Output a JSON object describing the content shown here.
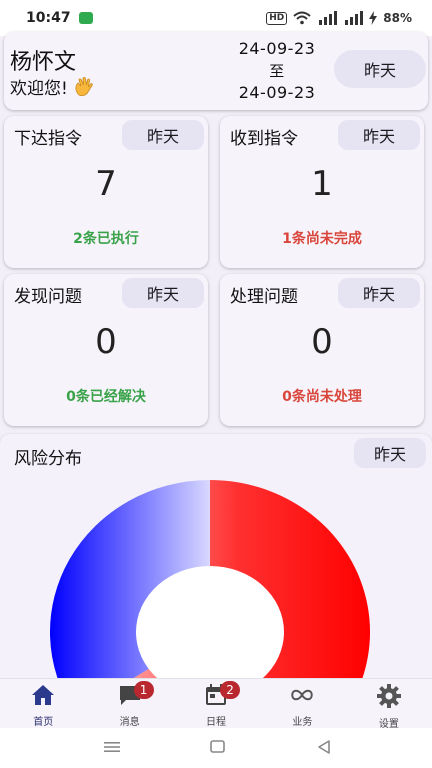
{
  "status_bar": {
    "time": "10:47",
    "hd": "HD",
    "battery": "88%"
  },
  "header": {
    "user_name": "杨怀文",
    "welcome": "欢迎您!",
    "date_from": "24-09-23",
    "date_sep": "至",
    "date_to": "24-09-23",
    "period_button": "昨天"
  },
  "cards": [
    {
      "title": "下达指令",
      "period": "昨天",
      "value": "7",
      "status": "2条已执行"
    },
    {
      "title": "收到指令",
      "period": "昨天",
      "value": "1",
      "status": "1条尚未完成"
    },
    {
      "title": "发现问题",
      "period": "昨天",
      "value": "0",
      "status": "0条已经解决"
    },
    {
      "title": "处理问题",
      "period": "昨天",
      "value": "0",
      "status": "0条尚未处理"
    }
  ],
  "risk": {
    "title": "风险分布",
    "period": "昨天",
    "colors": {
      "red": "#ff1a1a",
      "blue": "#1a1aff"
    }
  },
  "chart_data": {
    "type": "pie",
    "series": [
      {
        "color": "#ff1a1a",
        "value": 0.66
      },
      {
        "color": "#1a1aff",
        "value": 0.34
      }
    ]
  },
  "bottom_nav": {
    "items": [
      {
        "label": "首页",
        "icon": "home-icon",
        "active": true
      },
      {
        "label": "消息",
        "icon": "chat-icon",
        "badge": "1"
      },
      {
        "label": "日程",
        "icon": "calendar-icon",
        "badge": "2"
      },
      {
        "label": "业务",
        "icon": "infinity-icon"
      },
      {
        "label": "设置",
        "icon": "gear-icon"
      }
    ]
  },
  "colors": {
    "accent": "#2b2f6c",
    "pill_bg": "#e6e3f3",
    "badge": "#b8282e",
    "positive": "#3aa34a",
    "negative": "#d9463b"
  }
}
